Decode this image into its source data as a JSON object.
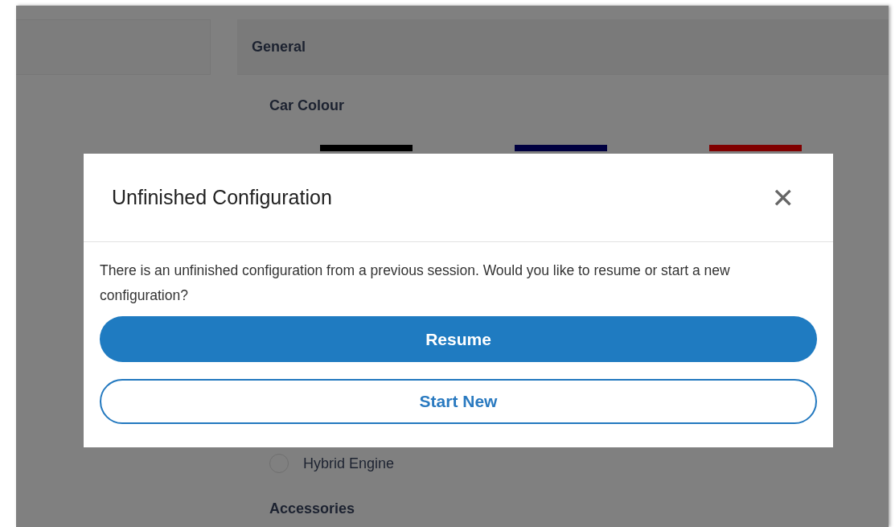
{
  "page": {
    "section_header": "General",
    "car_colour": {
      "label": "Car Colour",
      "swatches": [
        {
          "color": "#000000"
        },
        {
          "color": "#000040"
        },
        {
          "color": "#800000"
        }
      ]
    },
    "engine_options": [
      {
        "label": "Hybrid Engine",
        "selected": false
      }
    ],
    "accessories_label": "Accessories"
  },
  "dialog": {
    "title": "Unfinished Configuration",
    "close": "✕",
    "message": "There is an unfinished configuration from a previous session. Would you like to resume or start a new configuration?",
    "buttons": [
      {
        "label": "Resume",
        "kind": "primary"
      },
      {
        "label": "Start New",
        "kind": "outline"
      }
    ]
  }
}
